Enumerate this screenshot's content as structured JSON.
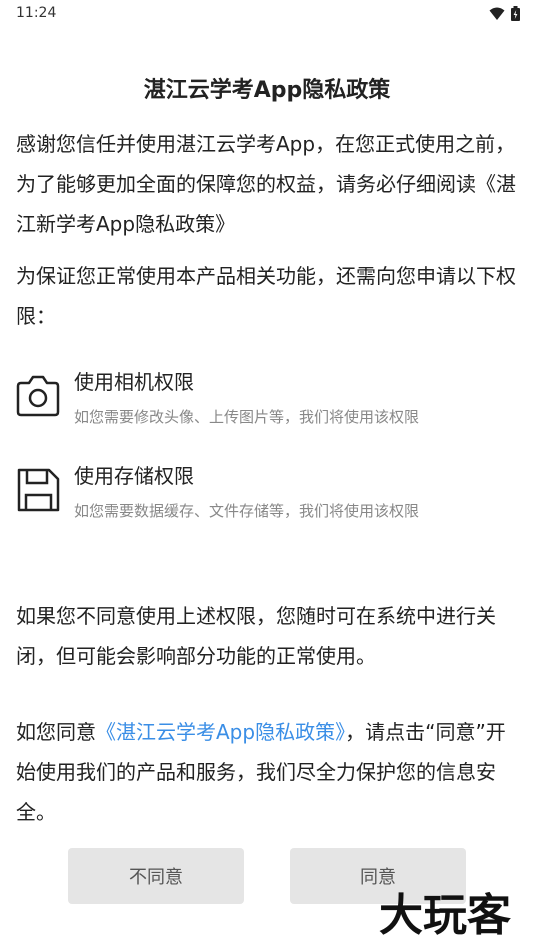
{
  "status_bar": {
    "time": "11:24",
    "icons": [
      "wifi-icon",
      "battery-icon"
    ]
  },
  "dialog": {
    "title": "湛江云学考App隐私政策",
    "intro": "感谢您信任并使用湛江云学考App，在您正式使用之前，为了能够更加全面的保障您的权益，请务必仔细阅读《湛江新学考App隐私政策》",
    "permissions_intro": "为保证您正常使用本产品相关功能，还需向您申请以下权限：",
    "permissions": [
      {
        "icon": "camera-icon",
        "title": "使用相机权限",
        "desc": "如您需要修改头像、上传图片等，我们将使用该权限"
      },
      {
        "icon": "floppy-disk-icon",
        "title": "使用存储权限",
        "desc": "如您需要数据缓存、文件存储等，我们将使用该权限"
      }
    ],
    "disagree_note": "如果您不同意使用上述权限，您随时可在系统中进行关闭，但可能会影响部分功能的正常使用。",
    "agree_prefix": "如您同意",
    "agree_link": "《湛江云学考App隐私政策》",
    "agree_suffix": "，请点击“同意”开始使用我们的产品和服务，我们尽全力保护您的信息安全。"
  },
  "buttons": {
    "disagree": "不同意",
    "agree": "同意"
  },
  "watermark": "大玩客"
}
